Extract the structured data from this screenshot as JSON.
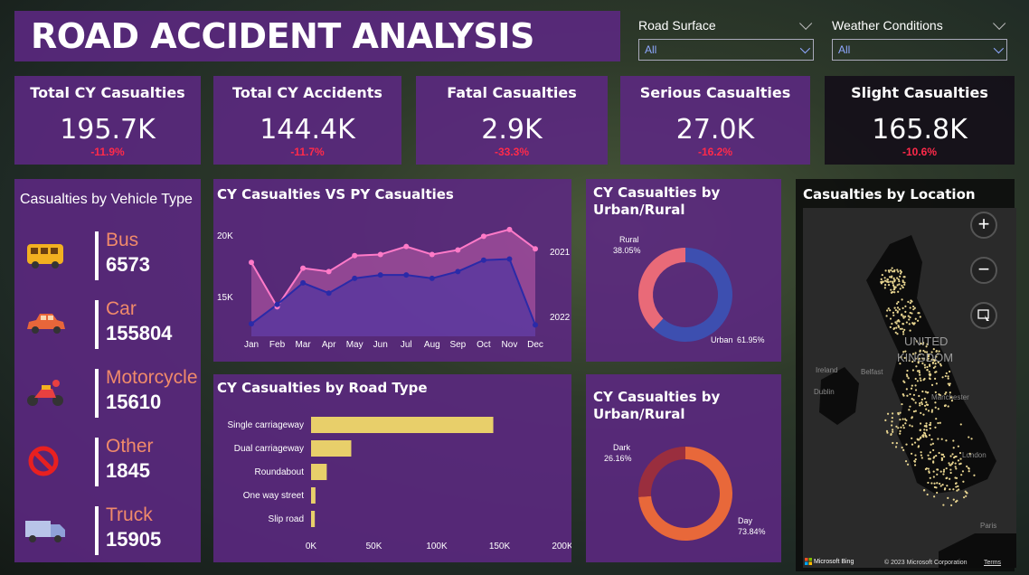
{
  "title": "ROAD ACCIDENT ANALYSIS",
  "slicers": [
    {
      "label": "Road Surface",
      "value": "All"
    },
    {
      "label": "Weather Conditions",
      "value": "All"
    }
  ],
  "kpis": [
    {
      "title": "Total CY Casualties",
      "value": "195.7K",
      "delta": "-11.9%"
    },
    {
      "title": "Total CY Accidents",
      "value": "144.4K",
      "delta": "-11.7%"
    },
    {
      "title": "Fatal Casualties",
      "value": "2.9K",
      "delta": "-33.3%"
    },
    {
      "title": "Serious Casualties",
      "value": "27.0K",
      "delta": "-16.2%"
    },
    {
      "title": "Slight Casualties",
      "value": "165.8K",
      "delta": "-10.6%"
    }
  ],
  "vehicle": {
    "title": "Casualties by Vehicle Type",
    "items": [
      {
        "name": "Bus",
        "value": "6573",
        "icon": "bus-icon"
      },
      {
        "name": "Car",
        "value": "155804",
        "icon": "car-icon"
      },
      {
        "name": "Motorcycle",
        "value": "15610",
        "icon": "motorcycle-icon"
      },
      {
        "name": "Other",
        "value": "1845",
        "icon": "prohibited-icon"
      },
      {
        "name": "Truck",
        "value": "15905",
        "icon": "truck-icon"
      }
    ]
  },
  "line_chart": {
    "title": "CY Casualties VS PY Casualties",
    "yticks": [
      "20K",
      "15K"
    ],
    "months": [
      "Jan",
      "Feb",
      "Mar",
      "Apr",
      "May",
      "Jun",
      "Jul",
      "Aug",
      "Sep",
      "Oct",
      "Nov",
      "Dec"
    ],
    "series_labels": [
      "2021",
      "2022"
    ]
  },
  "road_chart": {
    "title": "CY Casualties by Road Type",
    "xticks": [
      "0K",
      "50K",
      "100K",
      "150K",
      "200K"
    ]
  },
  "donut1": {
    "title_l1": "CY Casualties by",
    "title_l2": "Urban/Rural",
    "labels": [
      {
        "name": "Rural",
        "pct": "38.05%"
      },
      {
        "name": "Urban",
        "pct": "61.95%"
      }
    ]
  },
  "donut2": {
    "title_l1": "CY Casualties by",
    "title_l2": "Urban/Rural",
    "labels": [
      {
        "name": "Dark",
        "pct": "26.16%"
      },
      {
        "name": "Day",
        "pct": "73.84%"
      }
    ]
  },
  "map": {
    "title": "Casualties by Location",
    "country_l1": "UNITED",
    "country_l2": "KINGDOM",
    "place_labels": [
      "Ireland",
      "Dublin",
      "Belfast",
      "Manchester",
      "London",
      "Paris"
    ],
    "attribution": "© 2023 Microsoft Corporation",
    "terms": "Terms",
    "brand": "Microsoft Bing",
    "buttons": [
      "+",
      "−"
    ]
  },
  "colors": {
    "panel": "#5c2882",
    "cy_line": "#ff7ac8",
    "py_line": "#2a2aa8",
    "bar": "#e8cf6a",
    "rural": "#e96a78",
    "urban": "#3d4fb0",
    "dark": "#9a2e3e",
    "day": "#e8683a",
    "negative": "#ff2a4a"
  },
  "chart_data": [
    {
      "type": "area",
      "title": "CY Casualties VS PY Casualties",
      "categories": [
        "Jan",
        "Feb",
        "Mar",
        "Apr",
        "May",
        "Jun",
        "Jul",
        "Aug",
        "Sep",
        "Oct",
        "Nov",
        "Dec"
      ],
      "ylim": [
        12000,
        22500
      ],
      "series": [
        {
          "name": "2021",
          "values": [
            18500,
            14600,
            18000,
            17700,
            19100,
            19200,
            19900,
            19200,
            19600,
            20800,
            21400,
            19700
          ]
        },
        {
          "name": "2022",
          "values": [
            13100,
            14800,
            16700,
            15800,
            17100,
            17400,
            17400,
            17100,
            17700,
            18700,
            18800,
            13000
          ]
        }
      ]
    },
    {
      "type": "bar",
      "title": "CY Casualties by Road Type",
      "orientation": "horizontal",
      "categories": [
        "Single carriageway",
        "Dual carriageway",
        "Roundabout",
        "One way street",
        "Slip road"
      ],
      "values": [
        145000,
        32000,
        12500,
        3500,
        3000
      ],
      "xlim": [
        0,
        200000
      ]
    },
    {
      "type": "pie",
      "title": "CY Casualties by Urban/Rural",
      "categories": [
        "Rural",
        "Urban"
      ],
      "values": [
        38.05,
        61.95
      ]
    },
    {
      "type": "pie",
      "title": "CY Casualties by Urban/Rural",
      "categories": [
        "Dark",
        "Day"
      ],
      "values": [
        26.16,
        73.84
      ]
    }
  ]
}
